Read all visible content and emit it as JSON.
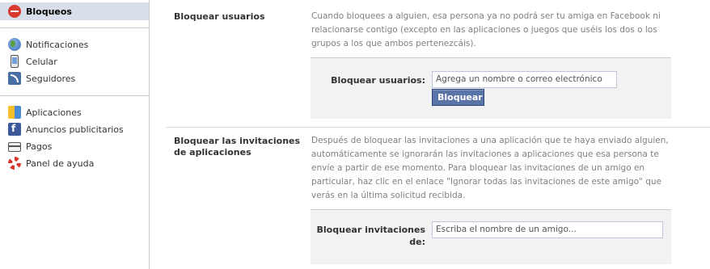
{
  "sidebar": {
    "items": [
      {
        "label": "Bloqueos",
        "icon": "block-icon",
        "active": true
      },
      {
        "label": "Notificaciones",
        "icon": "globe-icon"
      },
      {
        "label": "Celular",
        "icon": "phone-icon"
      },
      {
        "label": "Seguidores",
        "icon": "rss-icon"
      },
      {
        "label": "Aplicaciones",
        "icon": "apps-icon"
      },
      {
        "label": "Anuncios publicitarios",
        "icon": "ads-icon"
      },
      {
        "label": "Pagos",
        "icon": "payment-card-icon"
      },
      {
        "label": "Panel de ayuda",
        "icon": "lifebuoy-icon"
      }
    ]
  },
  "block_users": {
    "title": "Bloquear usuarios",
    "description": "Cuando bloquees a alguien, esa persona ya no podrá ser tu amiga en Facebook ni relacionarse contigo (excepto en las aplicaciones o juegos que uséis los dos o los grupos a los que ambos pertenezcáis).",
    "field_label": "Bloquear usuarios:",
    "input_placeholder": "Agrega un nombre o correo electrónico",
    "button_label": "Bloquear"
  },
  "block_app_invites": {
    "title": "Bloquear las invitaciones de aplicaciones",
    "description": "Después de bloquear las invitaciones a una aplicación que te haya enviado alguien, automáticamente se ignorarán las invitaciones a aplicaciones que esa persona te envíe a partir de ese momento. Para bloquear las invitaciones de un amigo en particular, haz clic en el enlace \"Ignorar todas las invitaciones de este amigo\" que verás en la última solicitud recibida.",
    "field_label": "Bloquear invitaciones de:",
    "input_placeholder": "Escriba el nombre de un amigo..."
  },
  "colors": {
    "accent": "#3b5998",
    "sidebar_active_bg": "#d8dfea",
    "button_bg": "#5b74a8",
    "box_bg": "#f2f2f2"
  }
}
